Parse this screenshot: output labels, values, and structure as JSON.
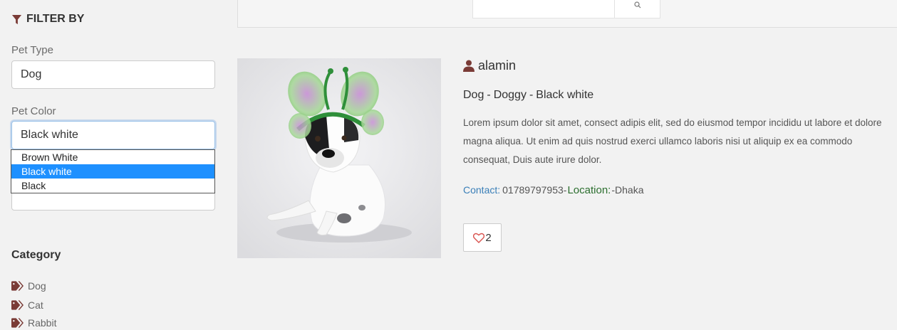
{
  "filter": {
    "title": "FILTER BY",
    "pet_type_label": "Pet Type",
    "pet_type_value": "Dog",
    "pet_color_label": "Pet Color",
    "pet_color_value": "Black white",
    "pet_color_options": [
      "Brown White",
      "Black white",
      "Black"
    ],
    "pet_color_selected_index": 1
  },
  "category": {
    "title": "Category",
    "items": [
      "Dog",
      "Cat",
      "Rabbit"
    ]
  },
  "pet": {
    "owner": "alamin",
    "type": "Dog",
    "separator": "-",
    "name": "Doggy",
    "color": "Black white",
    "description": "Lorem ipsum dolor sit amet, consect adipis elit, sed do eiusmod tempor incididu ut labore et dolore magna aliqua. Ut enim ad quis nostrud exerci ullamco laboris nisi ut aliquip ex ea commodo consequat, Duis aute irure dolor.",
    "contact_label": "Contact:",
    "contact_value": "01789797953",
    "location_label": "Location:",
    "location_value": "Dhaka",
    "likes": "2"
  },
  "colors": {
    "accent": "#7a3b36",
    "select_highlight": "#1e90ff",
    "contact_label": "#3a7fb8",
    "location_label": "#2b6e2e",
    "heart": "#d9534f"
  },
  "icons": {
    "filter": "filter-icon",
    "user": "user-icon",
    "tag": "tag-icon",
    "heart": "heart-icon",
    "search": "search-icon"
  }
}
